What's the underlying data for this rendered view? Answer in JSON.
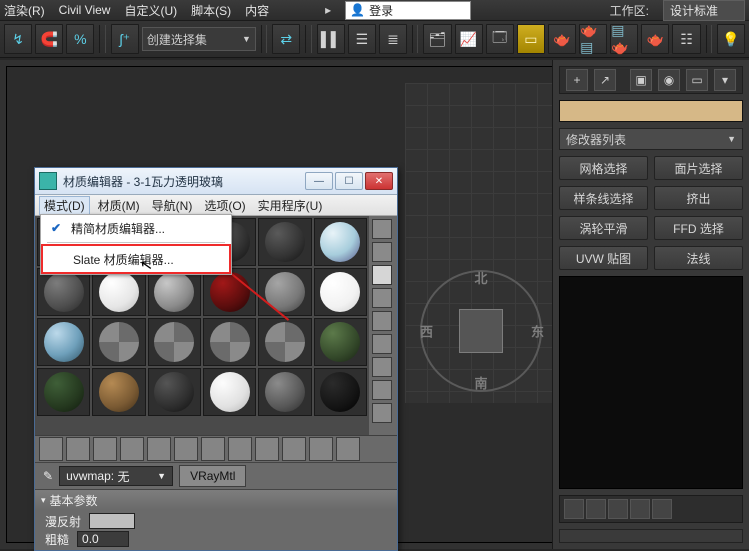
{
  "menubar": {
    "render": "渲染(R)",
    "civil": "Civil View",
    "custom": "自定义(U)",
    "script": "脚本(S)",
    "content": "内容",
    "login_icon": "user",
    "login_label": "登录",
    "ws_label": "工作区:",
    "ws_value": "设计标准"
  },
  "toolbar": {
    "set_combo": "创建选择集"
  },
  "right_panel": {
    "modlist": "修改器列表",
    "btns": [
      [
        "网格选择",
        "面片选择"
      ],
      [
        "样条线选择",
        "挤出"
      ],
      [
        "涡轮平滑",
        "FFD 选择"
      ],
      [
        "UVW 贴图",
        "法线"
      ]
    ]
  },
  "compass": {
    "n": "北",
    "s": "南",
    "e": "东",
    "w": "西"
  },
  "dialog": {
    "title": "材质编辑器 - 3-1瓦力透明玻璃",
    "menu": {
      "mode": "模式(D)",
      "material": "材质(M)",
      "nav": "导航(N)",
      "options": "选项(O)",
      "util": "实用程序(U)"
    },
    "dropdown": {
      "compact": "精简材质编辑器...",
      "slate": "Slate 材质编辑器..."
    },
    "field_label": "uvwmap:",
    "field_value": "无",
    "type_btn": "VRayMtl",
    "rollout": "基本参数",
    "diffuse": "漫反射",
    "rough": "粗糙",
    "rough_val": "0.0"
  }
}
